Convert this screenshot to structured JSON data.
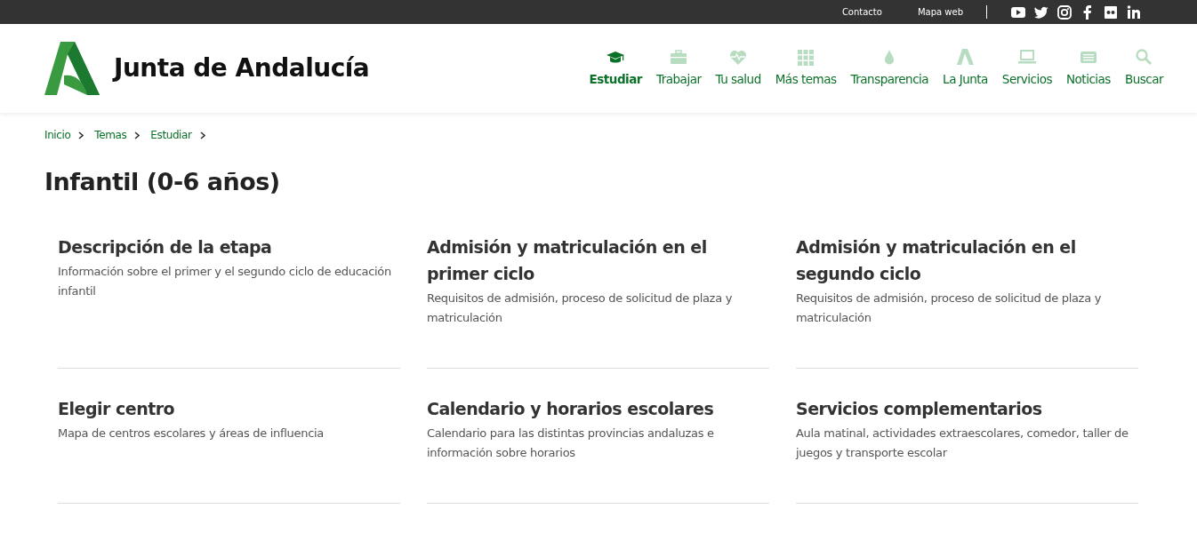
{
  "top_links": [
    "Contacto",
    "Mapa web"
  ],
  "logo": {
    "text": "Junta de Andalucía"
  },
  "nav": [
    {
      "label": "Estudiar",
      "selected": true
    },
    {
      "label": "Trabajar",
      "selected": false
    },
    {
      "label": "Tu salud",
      "selected": false
    },
    {
      "label": "Más temas",
      "selected": false
    },
    {
      "label": "Transparencia",
      "selected": false
    },
    {
      "label": "La Junta",
      "selected": false
    },
    {
      "label": "Servicios",
      "selected": false
    },
    {
      "label": "Noticias",
      "selected": false
    },
    {
      "label": "Buscar",
      "selected": false
    }
  ],
  "breadcrumb": [
    "Inicio",
    "Temas",
    "Estudiar"
  ],
  "title": "Infantil (0-6 años)",
  "cards": [
    {
      "title": "Descripción de la etapa",
      "description": "Información sobre el primer y el segundo ciclo de educación infantil"
    },
    {
      "title": "Admisión y matriculación en el primer ciclo",
      "description": "Requisitos de admisión, proceso de solicitud de plaza y matriculación"
    },
    {
      "title": "Admisión y matriculación en el segundo ciclo",
      "description": "Requisitos de admisión, proceso de solicitud de plaza y matriculación"
    },
    {
      "title": "Elegir centro",
      "description": "Mapa de centros escolares y áreas de influencia"
    },
    {
      "title": "Calendario y horarios escolares",
      "description": "Calendario para las distintas provincias andaluzas e información sobre horarios"
    },
    {
      "title": "Servicios complementarios",
      "description": "Aula matinal, actividades extraescolares, comedor, taller de juegos y transporte escolar"
    }
  ]
}
